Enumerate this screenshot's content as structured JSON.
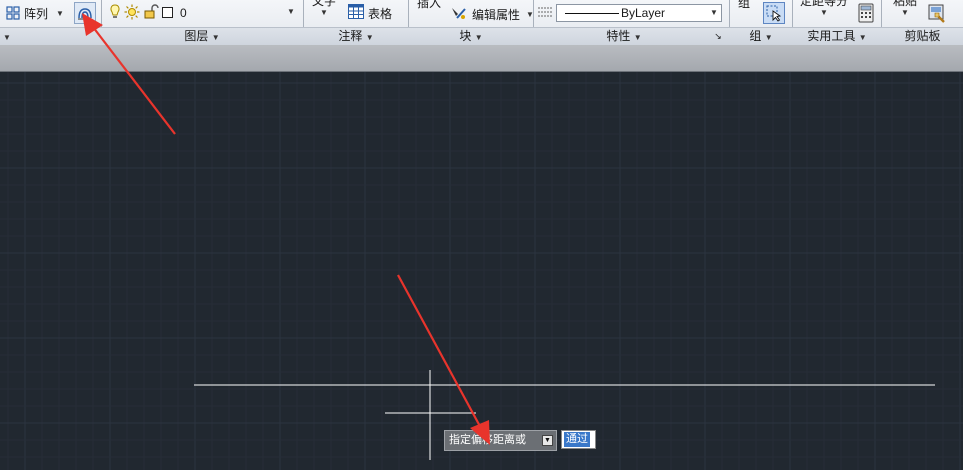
{
  "ribbon": {
    "modify": {
      "array_label": "阵列"
    },
    "layers": {
      "current_layer": "0",
      "panel_title": "图层"
    },
    "annotation": {
      "text_label": "文字",
      "table_label": "表格",
      "panel_title": "注释"
    },
    "block": {
      "insert_label": "插入",
      "edit_attr_label": "编辑属性",
      "panel_title": "块"
    },
    "properties": {
      "linetype_value": "ByLayer",
      "panel_title": "特性"
    },
    "group": {
      "group_label": "组",
      "panel_title": "组"
    },
    "utilities": {
      "measure_label": "定距等分",
      "panel_title": "实用工具"
    },
    "clipboard": {
      "paste_label": "粘贴",
      "panel_title": "剪贴板"
    }
  },
  "canvas": {
    "background": "#212830",
    "prompt_text": "指定偏移距离或",
    "prompt_input_value": "通过"
  },
  "colors": {
    "annotation_arrow": "#e8342c",
    "grid_major": "#2c3440",
    "grid_minor": "#262d37"
  }
}
